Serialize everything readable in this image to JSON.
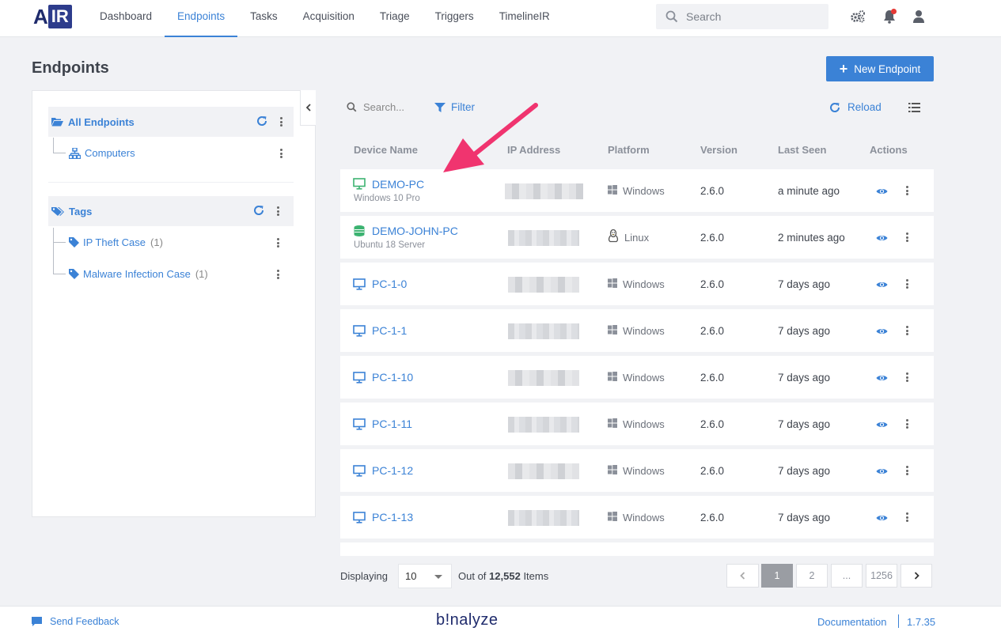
{
  "app": {
    "logo_a": "A",
    "logo_ir": "IR"
  },
  "nav": {
    "items": [
      {
        "label": "Dashboard"
      },
      {
        "label": "Endpoints",
        "active": true
      },
      {
        "label": "Tasks"
      },
      {
        "label": "Acquisition"
      },
      {
        "label": "Triage"
      },
      {
        "label": "Triggers"
      },
      {
        "label": "TimelineIR"
      }
    ]
  },
  "search": {
    "placeholder": "Search"
  },
  "page": {
    "title": "Endpoints",
    "new_button": "New Endpoint"
  },
  "tree": {
    "all_endpoints": "All Endpoints",
    "computers": "Computers",
    "tags": "Tags",
    "tag_items": [
      {
        "label": "IP Theft Case",
        "count": "(1)"
      },
      {
        "label": "Malware Infection Case",
        "count": "(1)"
      }
    ]
  },
  "toolbar": {
    "search_placeholder": "Search...",
    "filter": "Filter",
    "reload": "Reload"
  },
  "table": {
    "columns": [
      "Device Name",
      "IP Address",
      "Platform",
      "Version",
      "Last Seen",
      "Actions"
    ],
    "rows": [
      {
        "name": "DEMO-PC",
        "sub": "Windows 10 Pro",
        "platform": "Windows",
        "version": "2.6.0",
        "last_seen": "a minute ago",
        "online": true,
        "os": "windows"
      },
      {
        "name": "DEMO-JOHN-PC",
        "sub": "Ubuntu 18 Server",
        "platform": "Linux",
        "version": "2.6.0",
        "last_seen": "2 minutes ago",
        "online": true,
        "os": "linux"
      },
      {
        "name": "PC-1-0",
        "sub": "",
        "platform": "Windows",
        "version": "2.6.0",
        "last_seen": "7 days ago",
        "online": false,
        "os": "windows"
      },
      {
        "name": "PC-1-1",
        "sub": "",
        "platform": "Windows",
        "version": "2.6.0",
        "last_seen": "7 days ago",
        "online": false,
        "os": "windows"
      },
      {
        "name": "PC-1-10",
        "sub": "",
        "platform": "Windows",
        "version": "2.6.0",
        "last_seen": "7 days ago",
        "online": false,
        "os": "windows"
      },
      {
        "name": "PC-1-11",
        "sub": "",
        "platform": "Windows",
        "version": "2.6.0",
        "last_seen": "7 days ago",
        "online": false,
        "os": "windows"
      },
      {
        "name": "PC-1-12",
        "sub": "",
        "platform": "Windows",
        "version": "2.6.0",
        "last_seen": "7 days ago",
        "online": false,
        "os": "windows"
      },
      {
        "name": "PC-1-13",
        "sub": "",
        "platform": "Windows",
        "version": "2.6.0",
        "last_seen": "7 days ago",
        "online": false,
        "os": "windows"
      }
    ]
  },
  "pagination": {
    "displaying_label": "Displaying",
    "page_size": "10",
    "out_of_prefix": "Out of",
    "total": "12,552",
    "items_suffix": "Items",
    "pages": [
      "1",
      "2",
      "...",
      "1256"
    ],
    "current": "1"
  },
  "footer": {
    "feedback": "Send Feedback",
    "brand": "b!nalyze",
    "docs": "Documentation",
    "version": "1.7.35"
  },
  "colors": {
    "accent": "#3b82d6",
    "online": "#3cb371",
    "arrow": "#f0346f"
  }
}
